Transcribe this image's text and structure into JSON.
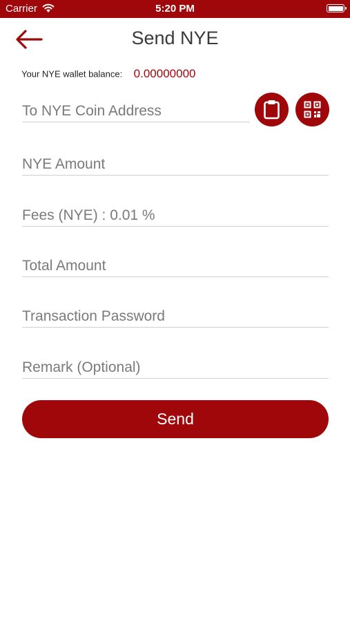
{
  "status_bar": {
    "carrier": "Carrier",
    "time": "5:20 PM"
  },
  "header": {
    "title": "Send NYE",
    "back_icon": "arrow-left-icon"
  },
  "balance": {
    "label": "Your NYE wallet balance:",
    "value": "0.00000000"
  },
  "form": {
    "address_placeholder": "To NYE Coin Address",
    "amount_placeholder": "NYE Amount",
    "fees_placeholder": "Fees (NYE) : 0.01 %",
    "total_placeholder": "Total Amount",
    "password_placeholder": "Transaction Password",
    "remark_placeholder": "Remark (Optional)",
    "paste_icon": "clipboard-icon",
    "scan_icon": "qr-code-icon"
  },
  "send_label": "Send",
  "colors": {
    "brand": "#a0070b",
    "text": "#3a3a3a",
    "placeholder": "#7a7a7a",
    "divider": "#cfcfcf"
  }
}
